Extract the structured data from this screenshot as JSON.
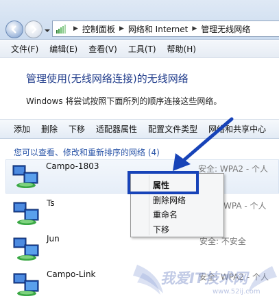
{
  "breadcrumb": {
    "items": [
      "控制面板",
      "网络和 Internet",
      "管理无线网络"
    ]
  },
  "menu": [
    "文件(F)",
    "编辑(E)",
    "查看(V)",
    "工具(T)",
    "帮助(H)"
  ],
  "page": {
    "heading": "管理使用(无线网络连接)的无线网络",
    "description": "Windows 将尝试按照下面所列的顺序连接这些网络。"
  },
  "toolbar": [
    "添加",
    "删除",
    "下移",
    "适配器属性",
    "配置文件类型",
    "网络和共享中心"
  ],
  "list_subtitle": "您可以查看、修改和重新排序的网络 (4)",
  "networks": [
    {
      "name": "Campo-1803",
      "security": "安全: WPA2 - 个人"
    },
    {
      "name": "Ts",
      "security": "WPA - 个人"
    },
    {
      "name": "Jun",
      "security": "安全: 不安全"
    },
    {
      "name": "Campo-Link",
      "security": "安全: WPA2 - 个人"
    }
  ],
  "context_menu": [
    "属性",
    "删除网络",
    "重命名",
    "下移"
  ],
  "watermark": {
    "main": "我爱IT技术网",
    "sub": "www.52ij.com"
  },
  "colors": {
    "highlight": "#1743b8",
    "heading": "#1e3a8a",
    "subtitle": "#2a55a8"
  }
}
